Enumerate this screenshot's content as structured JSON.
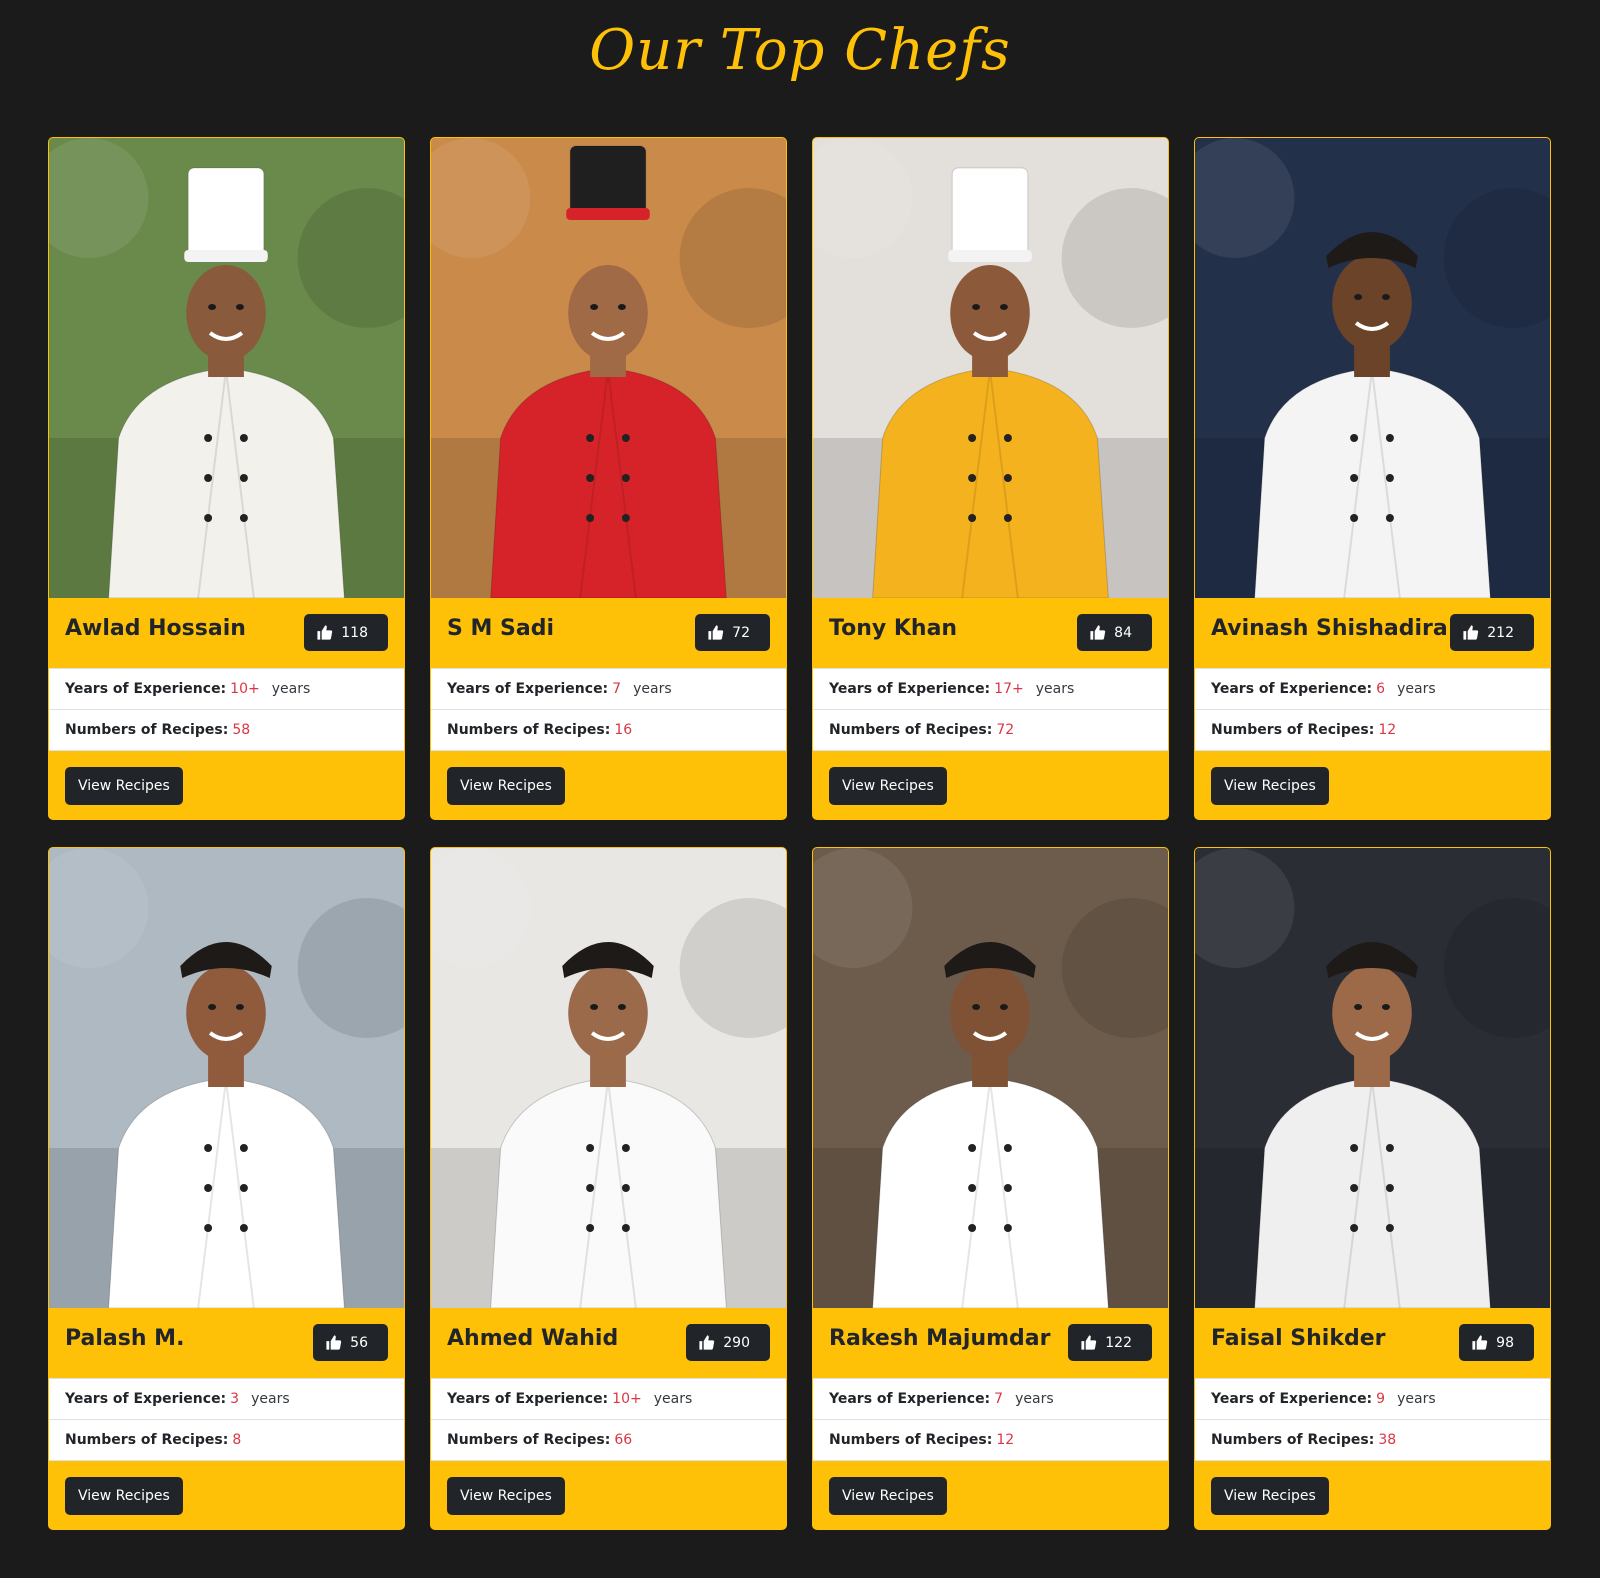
{
  "section": {
    "title": "Our Top Chefs"
  },
  "labels": {
    "experience": "Years of Experience:",
    "experience_unit": "years",
    "recipes": "Numbers of Recipes:",
    "button": "View Recipes"
  },
  "colors": {
    "background": "#1b1b1c",
    "accent": "#ffc107",
    "dark": "#212529",
    "value": "#dc3545"
  },
  "chefs": [
    {
      "name": "Awlad Hossain",
      "likes": "118",
      "experience": "10+",
      "recipes": "58",
      "jacket": "#f2f1ec",
      "hat": "#ffffff",
      "bg": "#6a8a4c",
      "skin": "#8a5a3c"
    },
    {
      "name": "S M Sadi",
      "likes": "72",
      "experience": "7",
      "recipes": "16",
      "jacket": "#d6232a",
      "hat": "#1f1f1f",
      "bg": "#c98a4a",
      "skin": "#a06a46"
    },
    {
      "name": "Tony Khan",
      "likes": "84",
      "experience": "17+",
      "recipes": "72",
      "jacket": "#f5b21f",
      "hat": "#ffffff",
      "bg": "#e3dfdb",
      "skin": "#8c5a3a"
    },
    {
      "name": "Avinash Shishadira",
      "likes": "212",
      "experience": "6",
      "recipes": "12",
      "jacket": "#f4f4f4",
      "hat": "",
      "bg": "#23304a",
      "skin": "#6b4328"
    },
    {
      "name": "Palash M.",
      "likes": "56",
      "experience": "3",
      "recipes": "8",
      "jacket": "#ffffff",
      "hat": "",
      "bg": "#aeb9c2",
      "skin": "#8f5b3c"
    },
    {
      "name": "Ahmed Wahid",
      "likes": "290",
      "experience": "10+",
      "recipes": "66",
      "jacket": "#fafafa",
      "hat": "",
      "bg": "#e9e7e4",
      "skin": "#9a6a4b"
    },
    {
      "name": "Rakesh Majumdar",
      "likes": "122",
      "experience": "7",
      "recipes": "12",
      "jacket": "#ffffff",
      "hat": "",
      "bg": "#6d5c4c",
      "skin": "#7f5135"
    },
    {
      "name": "Faisal Shikder",
      "likes": "98",
      "experience": "9",
      "recipes": "38",
      "jacket": "#efefef",
      "hat": "",
      "bg": "#2a2d34",
      "skin": "#9c6a48"
    }
  ]
}
